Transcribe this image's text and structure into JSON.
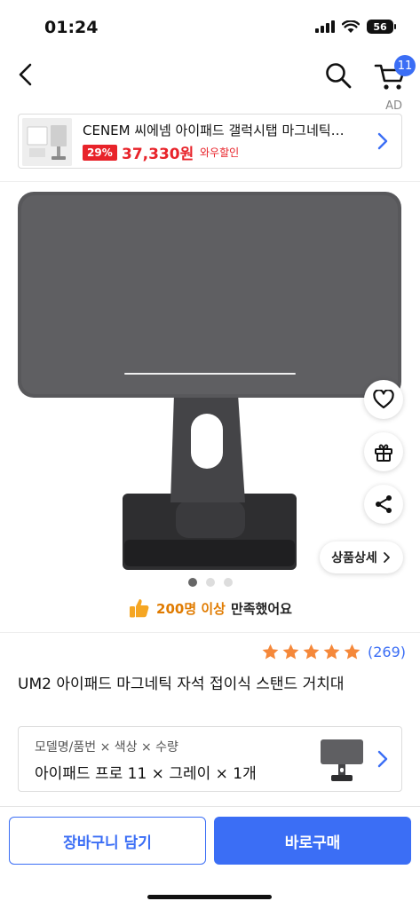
{
  "status_bar": {
    "time": "01:24",
    "battery": "56",
    "icons": [
      "signal-icon",
      "wifi-icon",
      "battery-icon"
    ]
  },
  "header": {
    "cart_count": "11",
    "icons": [
      "back-arrow-icon",
      "search-icon",
      "cart-icon"
    ]
  },
  "ad": {
    "label": "AD",
    "title": "CENEM 씨에넴 아이패드 갤럭시탭 마그네틱…",
    "discount": "29%",
    "price": "37,330원",
    "tag": "와우할인"
  },
  "gallery": {
    "total": 3,
    "active": 1,
    "side_icons": [
      "heart-icon",
      "gift-icon",
      "share-icon"
    ],
    "detail_button": "상품상세"
  },
  "satisfaction": {
    "count": "200명 이상",
    "text": "만족했어요"
  },
  "rating": {
    "stars": 5,
    "count": "(269)"
  },
  "product": {
    "title": "UM2 아이패드 마그네틱 자석 접이식 스탠드 거치대"
  },
  "options": {
    "label": "모델명/품번 × 색상 × 수량",
    "value": "아이패드 프로 11 × 그레이 × 1개"
  },
  "buttons": {
    "cart": "장바구니 담기",
    "buy": "바로구매"
  },
  "colors": {
    "accent": "#3b6ef5",
    "sale": "#e8232a",
    "star": "#f5883a",
    "satisfaction": "#e07b00"
  }
}
